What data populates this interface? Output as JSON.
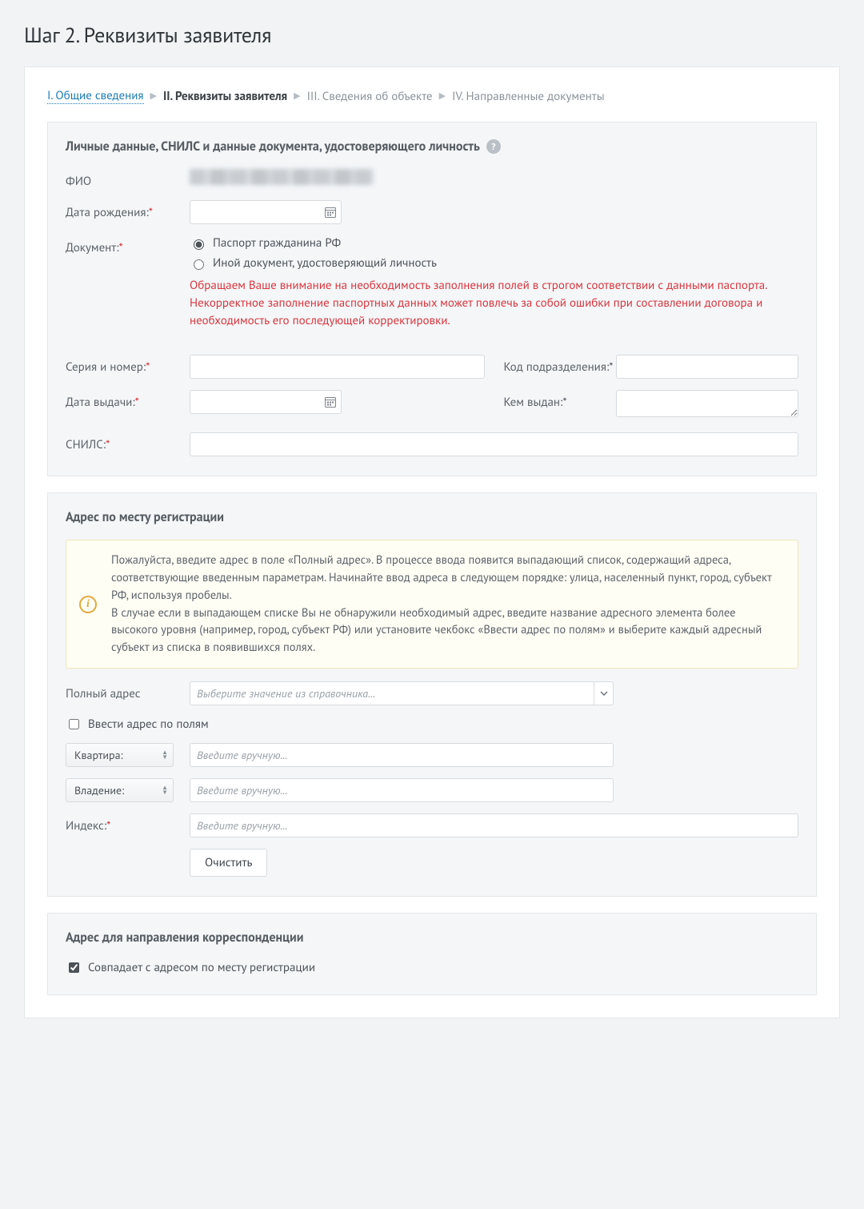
{
  "page_title": "Шаг 2. Реквизиты заявителя",
  "crumbs": {
    "step1": "I. Общие сведения",
    "step2": "II. Реквизиты заявителя",
    "step3": "III. Сведения об объекте",
    "step4": "IV. Направленные документы"
  },
  "section_personal": {
    "title": "Личные данные, СНИЛС и данные документа, удостоверяющего личность",
    "labels": {
      "fio": "ФИО",
      "dob": "Дата рождения:",
      "doc": "Документ:",
      "series": "Серия и номер:",
      "dept": "Код подразделения:",
      "issue_date": "Дата выдачи:",
      "issued_by": "Кем выдан:",
      "snils": "СНИЛС:"
    },
    "doc_options": {
      "passport": "Паспорт гражданина РФ",
      "other": "Иной документ, удостоверяющий личность"
    },
    "warning": "Обращаем Ваше внимание на необходимость заполнения полей в строгом соответствии с данными паспорта. Некорректное заполнение паспортных данных может повлечь за собой ошибки при составлении договора и необходимость его последующей корректировки."
  },
  "section_reg_addr": {
    "title": "Адрес по месту регистрации",
    "notice": "Пожалуйста, введите адрес в поле «Полный адрес». В процессе ввода появится выпадающий список, содержащий адреса, соответствующие введенным параметрам. Начинайте ввод адреса в следующем порядке: улица, населенный пункт, город, субъект РФ, используя пробелы.\nВ случае если в выпадающем списке Вы не обнаружили необходимый адрес, введите название адресного элемента более высокого уровня (например, город, субъект РФ) или установите чекбокс «Ввести адрес по полям» и выберите каждый адресный субъект из списка в появившихся полях.",
    "labels": {
      "full_addr": "Полный адрес",
      "manual_cb": "Ввести адрес по полям",
      "flat_select": "Квартира:",
      "own_select": "Владение:",
      "index": "Индекс:"
    },
    "placeholders": {
      "full_addr": "Выберите значение из справочника...",
      "manual": "Введите вручную..."
    },
    "clear_btn": "Очистить"
  },
  "section_mail_addr": {
    "title": "Адрес для направления корреспонденции",
    "same_cb": "Совпадает с адресом по месту регистрации"
  },
  "req_mark": "*"
}
